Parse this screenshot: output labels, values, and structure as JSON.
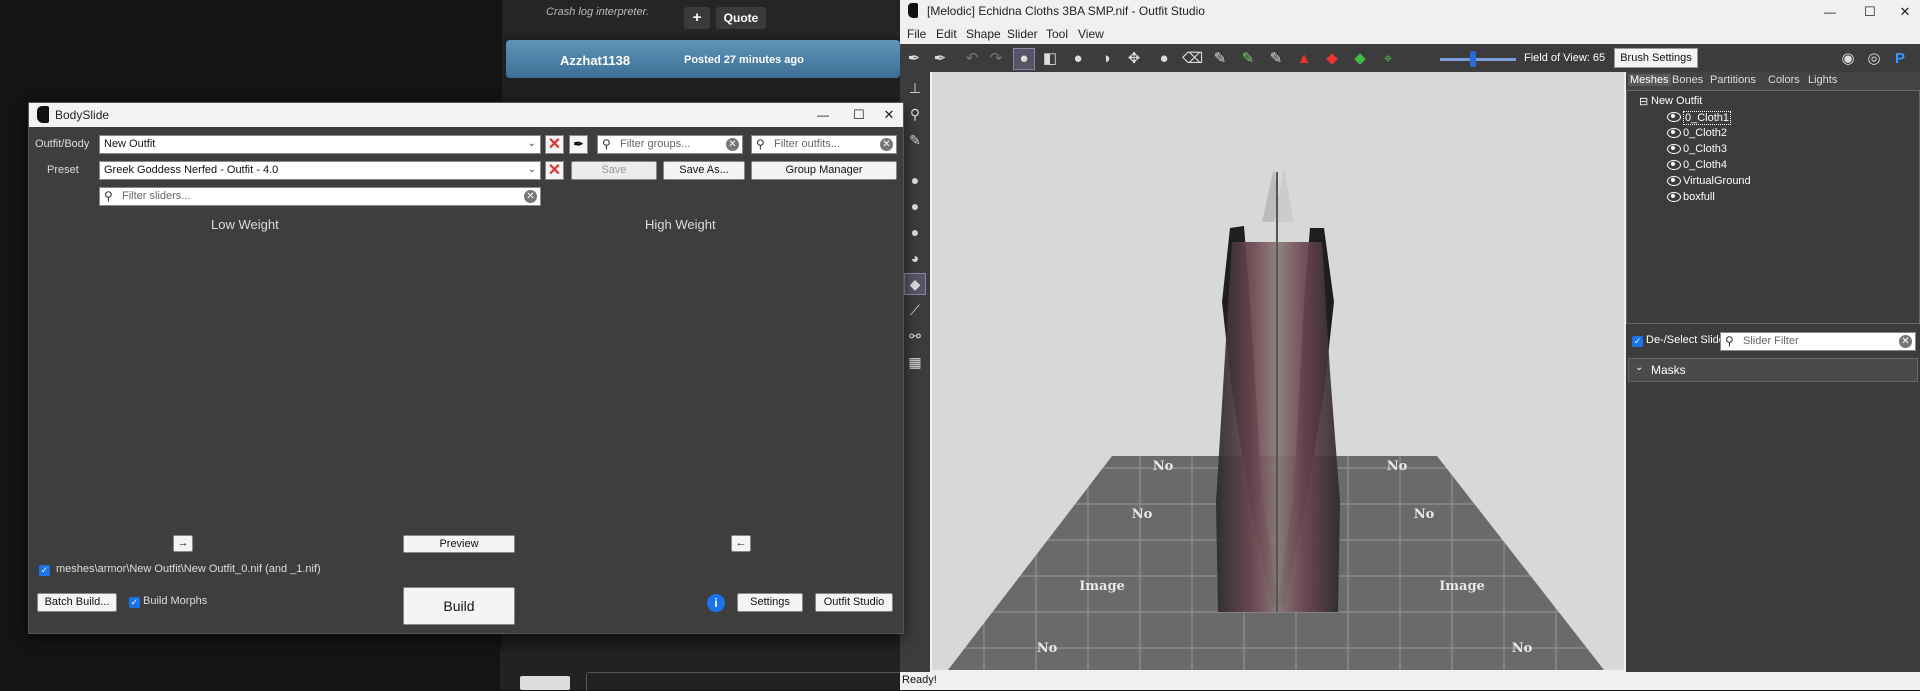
{
  "forum": {
    "crash_text": "Crash log interpreter.",
    "plus_label": "+",
    "quote_label": "Quote",
    "post_user": "Azzhat1138",
    "post_time": "Posted 27 minutes ago"
  },
  "bodyslide": {
    "title": "BodySlide",
    "outfit_label": "Outfit/Body",
    "outfit_value": "New Outfit",
    "preset_label": "Preset",
    "preset_value": "Greek Goddess Nerfed - Outfit - 4.0",
    "filter_groups_placeholder": "Filter groups...",
    "filter_outfits_placeholder": "Filter outfits...",
    "filter_sliders_placeholder": "Filter sliders...",
    "save_label": "Save",
    "save_as_label": "Save As...",
    "group_manager_label": "Group Manager",
    "low_weight": "Low Weight",
    "high_weight": "High Weight",
    "arrow_right": "→",
    "arrow_left": "←",
    "preview_label": "Preview",
    "output_path": "meshes\\armor\\New Outfit\\New Outfit_0.nif (and _1.nif)",
    "batch_build_label": "Batch Build...",
    "build_morphs_label": "Build Morphs",
    "build_label": "Build",
    "settings_label": "Settings",
    "outfit_studio_label": "Outfit Studio",
    "minimize": "—",
    "maximize": "☐",
    "close": "✕"
  },
  "outfit_studio": {
    "title": "[Melodic] Echidna Cloths 3BA SMP.nif - Outfit Studio",
    "menu": [
      "File",
      "Edit",
      "Shape",
      "Slider",
      "Tool",
      "View"
    ],
    "fov_label": "Field of View: 65",
    "brush_settings_label": "Brush Settings",
    "tabs": [
      "Meshes",
      "Bones",
      "Partitions",
      "Colors",
      "Lights"
    ],
    "tree_root": "New Outfit",
    "meshes": [
      "0_Cloth1",
      "0_Cloth2",
      "0_Cloth3",
      "0_Cloth4",
      "VirtualGround",
      "boxfull"
    ],
    "deselect_label": "De-/Select Sliders",
    "slider_filter_placeholder": "Slider Filter",
    "masks_label": "Masks",
    "status": "Ready!",
    "tile_text_1": "No",
    "tile_text_2": "Image"
  },
  "colors": {
    "accent": "#1a73e8",
    "post_bar": "#4a7fa7",
    "panel": "#3e3e3e"
  }
}
